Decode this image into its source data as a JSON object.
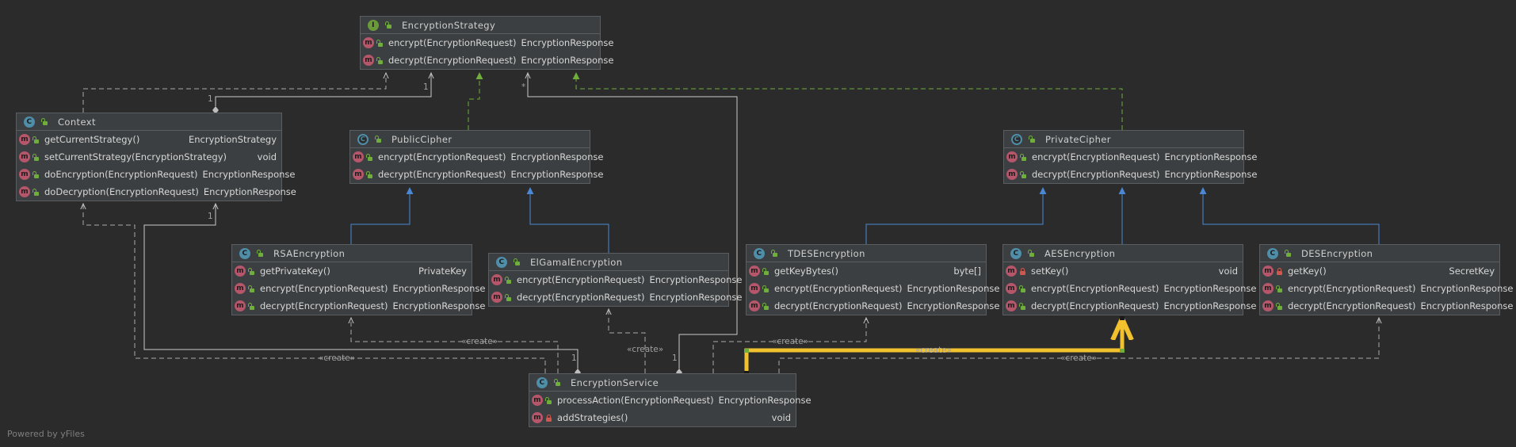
{
  "footer": "Powered by yFiles",
  "nodes": {
    "encryption_strategy": {
      "name": "EncryptionStrategy",
      "kind": "interface",
      "members": [
        {
          "sig": "encrypt(EncryptionRequest)",
          "ret": "EncryptionResponse"
        },
        {
          "sig": "decrypt(EncryptionRequest)",
          "ret": "EncryptionResponse"
        }
      ]
    },
    "context": {
      "name": "Context",
      "kind": "class",
      "members": [
        {
          "sig": "getCurrentStrategy()",
          "ret": "EncryptionStrategy"
        },
        {
          "sig": "setCurrentStrategy(EncryptionStrategy)",
          "ret": "void"
        },
        {
          "sig": "doEncryption(EncryptionRequest)",
          "ret": "EncryptionResponse"
        },
        {
          "sig": "doDecryption(EncryptionRequest)",
          "ret": "EncryptionResponse"
        }
      ]
    },
    "public_cipher": {
      "name": "PublicCipher",
      "kind": "abstract",
      "members": [
        {
          "sig": "encrypt(EncryptionRequest)",
          "ret": "EncryptionResponse"
        },
        {
          "sig": "decrypt(EncryptionRequest)",
          "ret": "EncryptionResponse"
        }
      ]
    },
    "private_cipher": {
      "name": "PrivateCipher",
      "kind": "abstract",
      "members": [
        {
          "sig": "encrypt(EncryptionRequest)",
          "ret": "EncryptionResponse"
        },
        {
          "sig": "decrypt(EncryptionRequest)",
          "ret": "EncryptionResponse"
        }
      ]
    },
    "rsa": {
      "name": "RSAEncryption",
      "kind": "class",
      "members": [
        {
          "sig": "getPrivateKey()",
          "ret": "PrivateKey"
        },
        {
          "sig": "encrypt(EncryptionRequest)",
          "ret": "EncryptionResponse"
        },
        {
          "sig": "decrypt(EncryptionRequest)",
          "ret": "EncryptionResponse"
        }
      ]
    },
    "elgamal": {
      "name": "ElGamalEncryption",
      "kind": "class",
      "members": [
        {
          "sig": "encrypt(EncryptionRequest)",
          "ret": "EncryptionResponse"
        },
        {
          "sig": "decrypt(EncryptionRequest)",
          "ret": "EncryptionResponse"
        }
      ]
    },
    "tdes": {
      "name": "TDESEncryption",
      "kind": "class",
      "members": [
        {
          "sig": "getKeyBytes()",
          "ret": "byte[]"
        },
        {
          "sig": "encrypt(EncryptionRequest)",
          "ret": "EncryptionResponse"
        },
        {
          "sig": "decrypt(EncryptionRequest)",
          "ret": "EncryptionResponse"
        }
      ]
    },
    "aes": {
      "name": "AESEncryption",
      "kind": "class",
      "members": [
        {
          "sig": "setKey()",
          "ret": "void",
          "private": true
        },
        {
          "sig": "encrypt(EncryptionRequest)",
          "ret": "EncryptionResponse"
        },
        {
          "sig": "decrypt(EncryptionRequest)",
          "ret": "EncryptionResponse"
        }
      ]
    },
    "des": {
      "name": "DESEncryption",
      "kind": "class",
      "members": [
        {
          "sig": "getKey()",
          "ret": "SecretKey",
          "private": true
        },
        {
          "sig": "encrypt(EncryptionRequest)",
          "ret": "EncryptionResponse"
        },
        {
          "sig": "decrypt(EncryptionRequest)",
          "ret": "EncryptionResponse"
        }
      ]
    },
    "service": {
      "name": "EncryptionService",
      "kind": "class",
      "members": [
        {
          "sig": "processAction(EncryptionRequest)",
          "ret": "EncryptionResponse"
        },
        {
          "sig": "addStrategies()",
          "ret": "void",
          "private": true
        }
      ]
    }
  },
  "edge_labels": {
    "create": "«create»",
    "one": "1",
    "many": "*"
  },
  "colors": {
    "background": "#2b2b2b",
    "node_fill": "#3c3f41",
    "inheritance": "#4a88d6",
    "realization": "#6fae3c",
    "dependency": "#a9a9a9",
    "association": "#c8c8c8",
    "selected_edge": "#f2c12e"
  }
}
